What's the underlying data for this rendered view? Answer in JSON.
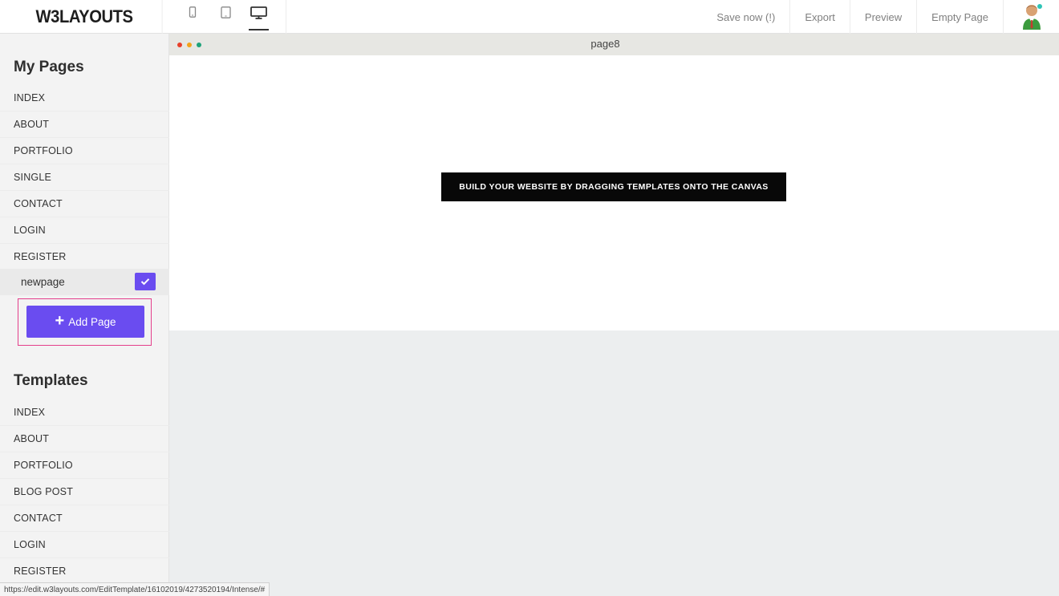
{
  "header": {
    "logo": "W3LAYOUTS",
    "devices": [
      {
        "icon": "mobile-icon"
      },
      {
        "icon": "tablet-icon"
      },
      {
        "icon": "desktop-icon",
        "active": true
      }
    ],
    "menu": [
      "Save now (!)",
      "Export",
      "Preview",
      "Empty Page"
    ],
    "avatar": "user-avatar-icon"
  },
  "sidebar": {
    "my_pages_title": "My Pages",
    "my_pages": [
      "INDEX",
      "ABOUT",
      "PORTFOLIO",
      "SINGLE",
      "CONTACT",
      "LOGIN",
      "REGISTER"
    ],
    "new_page_value": "newpage",
    "add_page_label": "Add Page",
    "templates_title": "Templates",
    "templates": [
      "INDEX",
      "ABOUT",
      "PORTFOLIO",
      "BLOG POST",
      "CONTACT",
      "LOGIN",
      "REGISTER"
    ]
  },
  "canvas": {
    "page_name": "page8",
    "dots": [
      "#e8402a",
      "#f4a31a",
      "#1fa37a"
    ],
    "hint": "BUILD YOUR WEBSITE BY DRAGGING TEMPLATES ONTO THE CANVAS"
  },
  "status_url": "https://edit.w3layouts.com/EditTemplate/16102019/4273520194/Intense/#",
  "colors": {
    "accent": "#6a4cf0",
    "highlight_border": "#e43f8b"
  }
}
